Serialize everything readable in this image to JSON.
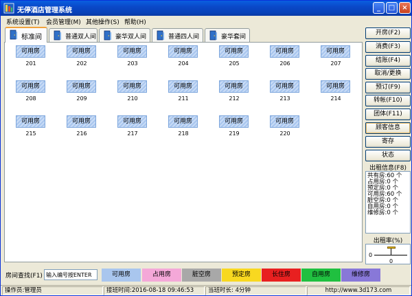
{
  "window": {
    "title": "无停酒店管理系统",
    "min_glyph": "_",
    "max_glyph": "□",
    "close_glyph": "×"
  },
  "menu": [
    {
      "label": "系统设置(T)"
    },
    {
      "label": "会员管理(M)"
    },
    {
      "label": "其他操作(S)"
    },
    {
      "label": "帮助(H)"
    }
  ],
  "tabs": [
    {
      "label": "标准间",
      "active": true
    },
    {
      "label": "普通双人间"
    },
    {
      "label": "豪华双人间"
    },
    {
      "label": "普通四人间"
    },
    {
      "label": "豪华套间"
    }
  ],
  "rooms": [
    {
      "status": "可用房",
      "number": "201"
    },
    {
      "status": "可用房",
      "number": "202"
    },
    {
      "status": "可用房",
      "number": "203"
    },
    {
      "status": "可用房",
      "number": "204"
    },
    {
      "status": "可用房",
      "number": "205"
    },
    {
      "status": "可用房",
      "number": "206"
    },
    {
      "status": "可用房",
      "number": "207"
    },
    {
      "status": "可用房",
      "number": "208"
    },
    {
      "status": "可用房",
      "number": "209"
    },
    {
      "status": "可用房",
      "number": "210"
    },
    {
      "status": "可用房",
      "number": "211"
    },
    {
      "status": "可用房",
      "number": "212"
    },
    {
      "status": "可用房",
      "number": "213"
    },
    {
      "status": "可用房",
      "number": "214"
    },
    {
      "status": "可用房",
      "number": "215"
    },
    {
      "status": "可用房",
      "number": "216"
    },
    {
      "status": "可用房",
      "number": "217"
    },
    {
      "status": "可用房",
      "number": "218"
    },
    {
      "status": "可用房",
      "number": "219"
    },
    {
      "status": "可用房",
      "number": "220"
    }
  ],
  "actions": [
    {
      "label": "开房(F2)"
    },
    {
      "label": "消费(F3)"
    },
    {
      "label": "结账(F4)"
    },
    {
      "label": "取消/更换"
    },
    {
      "label": "预订(F9)"
    },
    {
      "label": "转帐(F10)"
    },
    {
      "label": "团体(F11)"
    },
    {
      "label": "顾客信息"
    },
    {
      "label": "寄存"
    },
    {
      "label": "状态"
    }
  ],
  "stats": {
    "title": "出租信息(F8)",
    "lines": [
      {
        "label": "共有房:",
        "value": "60",
        "unit": "个"
      },
      {
        "label": "占用房:",
        "value": "0",
        "unit": "个"
      },
      {
        "label": "预定房:",
        "value": "0",
        "unit": "个"
      },
      {
        "label": "可用房:",
        "value": "60",
        "unit": "个"
      },
      {
        "label": "脏空房:",
        "value": "0",
        "unit": "个"
      },
      {
        "label": "自用房:",
        "value": "0",
        "unit": "个"
      },
      {
        "label": "维修房:",
        "value": "0",
        "unit": "个"
      }
    ]
  },
  "rate": {
    "title": "出租率(%)",
    "axis_left": "0",
    "axis_bottom": "0",
    "value": 0
  },
  "search": {
    "label": "房间查找(F1)",
    "value": "输入编号按ENTER"
  },
  "legend": [
    {
      "label": "可用房",
      "color": "#a9c6ee",
      "text_color": "#000000",
      "name": "legend-available"
    },
    {
      "label": "占用房",
      "color": "#f4a8d8",
      "text_color": "#000000",
      "name": "legend-occupied"
    },
    {
      "label": "脏空房",
      "color": "#a8a8a8",
      "text_color": "#000000",
      "name": "legend-dirty"
    },
    {
      "label": "预定房",
      "color": "#f8d820",
      "text_color": "#000000",
      "name": "legend-reserved"
    },
    {
      "label": "长住房",
      "color": "#e82020",
      "text_color": "#000000",
      "name": "legend-long-stay"
    },
    {
      "label": "自用房",
      "color": "#20c040",
      "text_color": "#000000",
      "name": "legend-self-use"
    },
    {
      "label": "维修房",
      "color": "#8878d8",
      "text_color": "#000000",
      "name": "legend-maintenance"
    }
  ],
  "status": {
    "operator": "操作员:管理员",
    "shift_time": "接班时间:2016-08-18 09:46:53",
    "shift_duration": "当班时长: 4分钟",
    "url": "http://www.3d173.com"
  },
  "colors": {
    "titlebar": "#0a48c8",
    "tab_accent": "#f0a23c",
    "room_available": "#a9c6ee"
  }
}
